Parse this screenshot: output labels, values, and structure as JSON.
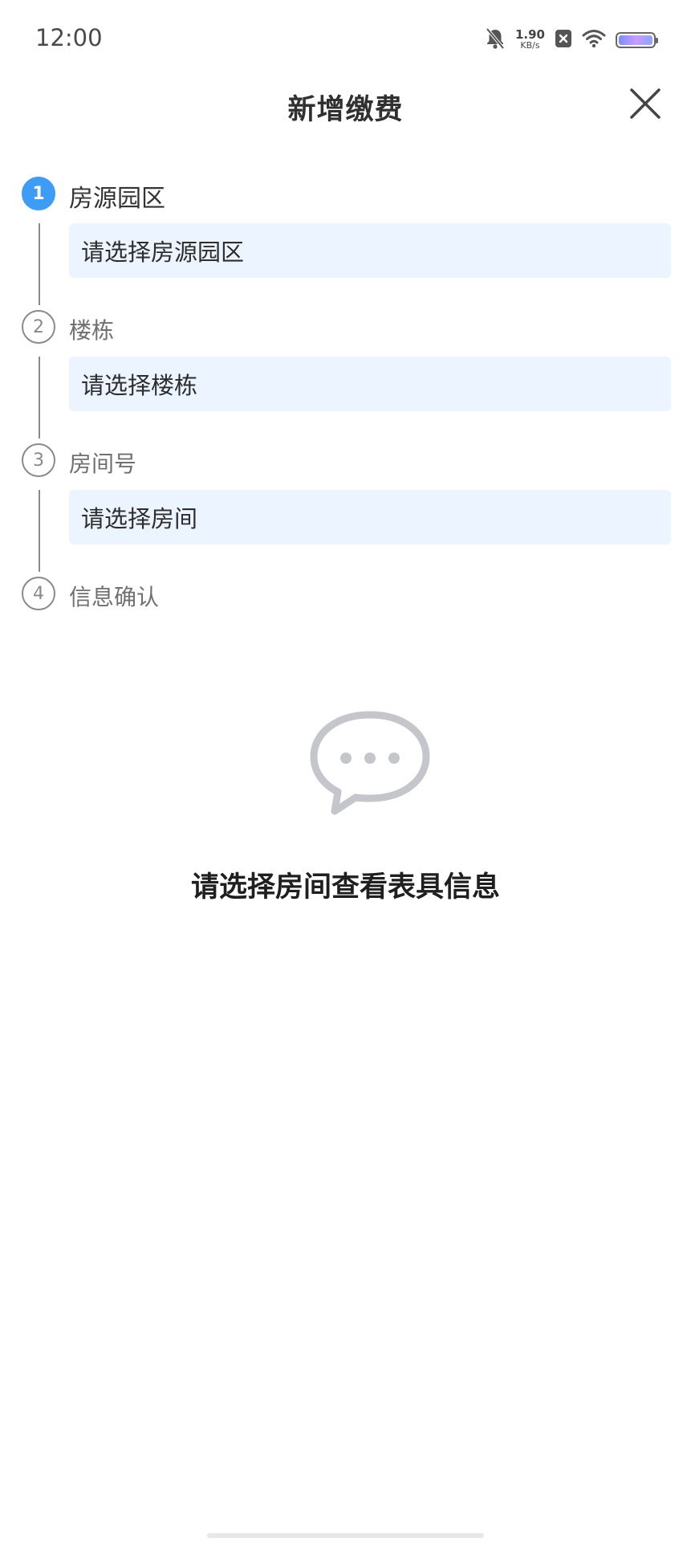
{
  "status_bar": {
    "time": "12:00",
    "network_speed_value": "1.90",
    "network_speed_unit": "KB/s",
    "icons": [
      "bell-off-icon",
      "x-box-icon",
      "wifi-icon",
      "battery-icon"
    ]
  },
  "header": {
    "title": "新增缴费",
    "close_icon": "close-icon"
  },
  "steps": [
    {
      "number": "1",
      "label": "房源园区",
      "placeholder": "请选择房源园区",
      "active": true
    },
    {
      "number": "2",
      "label": "楼栋",
      "placeholder": "请选择楼栋",
      "active": false
    },
    {
      "number": "3",
      "label": "房间号",
      "placeholder": "请选择房间",
      "active": false
    },
    {
      "number": "4",
      "label": "信息确认",
      "active": false
    }
  ],
  "empty_state": {
    "icon": "chat-bubble-icon",
    "message": "请选择房间查看表具信息"
  },
  "colors": {
    "accent": "#3d9cf5",
    "select_bg": "#ecf5ff",
    "inactive": "#8a8a8a",
    "icon_gray": "#c4c6cc"
  }
}
